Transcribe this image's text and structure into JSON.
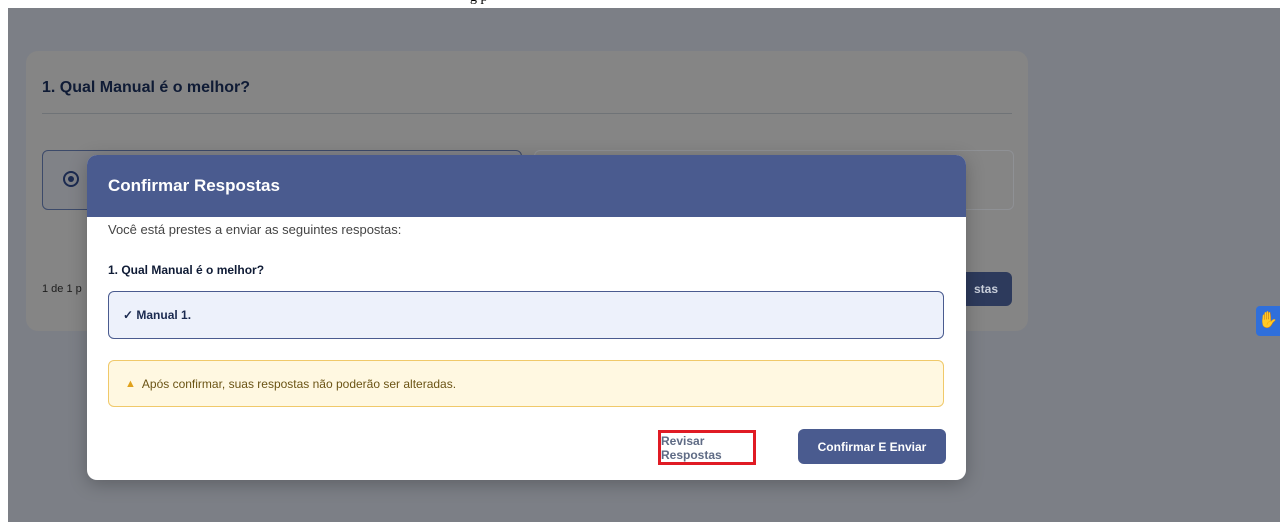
{
  "top_strip_text": "g                                         p",
  "quiz": {
    "question_title": "1. Qual Manual é o melhor?",
    "pager_text": "1 de 1 p",
    "bg_button_label": "stas"
  },
  "modal": {
    "title": "Confirmar Respostas",
    "intro": "Você está prestes a enviar as seguintes respostas:",
    "question": "1. Qual Manual é o melhor?",
    "answer": "✓ Manual 1.",
    "warning_icon": "warning-icon",
    "warning": "Após confirmar, suas respostas não poderão ser alteradas.",
    "review_button": "Revisar Respostas",
    "confirm_button": "Confirmar E Enviar"
  },
  "colors": {
    "modal_header": "#4a5b8f",
    "highlight": "#e01b24",
    "warning_border": "#f0c96a"
  }
}
